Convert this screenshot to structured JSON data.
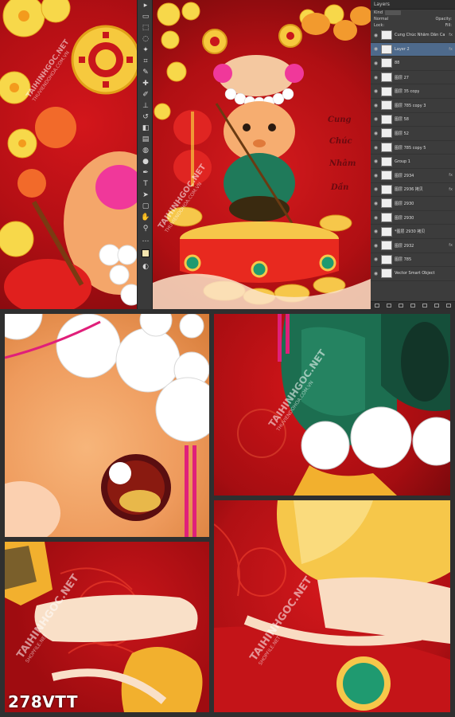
{
  "layers_panel": {
    "title": "Layers",
    "filter_label": "Kind",
    "blend_mode": "Normal",
    "opacity_label": "Opacity:",
    "lock_label": "Lock:",
    "fill_label": "Fill:",
    "items": [
      {
        "name": "Cung Chúc Nhâm Dần Ca",
        "fx": "fx"
      },
      {
        "name": "Layer 2",
        "fx": "fx"
      },
      {
        "name": "88",
        "fx": ""
      },
      {
        "name": "图层 27",
        "fx": ""
      },
      {
        "name": "图层 35 copy",
        "fx": ""
      },
      {
        "name": "图层 785 copy 3",
        "fx": ""
      },
      {
        "name": "图层 58",
        "fx": ""
      },
      {
        "name": "图层 52",
        "fx": ""
      },
      {
        "name": "图层 785 copy 5",
        "fx": ""
      },
      {
        "name": "Group 1",
        "fx": ""
      },
      {
        "name": "图层 2934",
        "fx": "fx"
      },
      {
        "name": "图层 2936 拷贝",
        "fx": "fx"
      },
      {
        "name": "图层 2930",
        "fx": ""
      },
      {
        "name": "图层 2930",
        "fx": ""
      },
      {
        "name": "*图层 2930 拷贝",
        "fx": ""
      },
      {
        "name": "图层 2932",
        "fx": "fx"
      },
      {
        "name": "图层 785",
        "fx": ""
      },
      {
        "name": "Vector Smart Object",
        "fx": ""
      }
    ]
  },
  "canvas": {
    "greeting_lines": [
      "Cung",
      "Chúc",
      "Nhâm",
      "Dần"
    ]
  },
  "watermark": {
    "main": "TAIHINHGOC.NET",
    "second": "SHOPFILE.NET",
    "url": "THUVIENDOHOA.COM.VN"
  },
  "product_code": "278VTT",
  "colors": {
    "red": "#c8161b",
    "gold": "#f5c542",
    "pearl": "#ffffff",
    "jade": "#1f7a5a"
  }
}
